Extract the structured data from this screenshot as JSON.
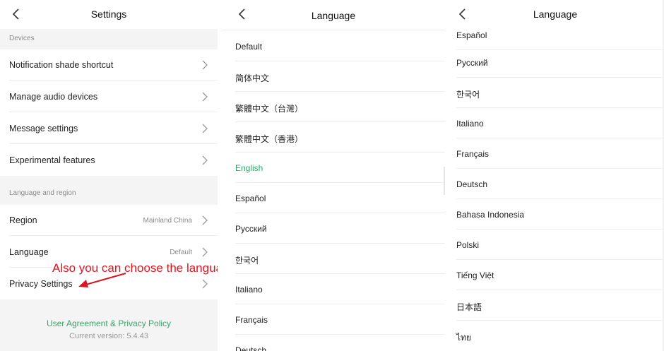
{
  "settings": {
    "title": "Settings",
    "section_devices": "Devices",
    "devices_items": [
      {
        "label": "Notification shade shortcut"
      },
      {
        "label": "Manage audio devices"
      },
      {
        "label": "Message settings"
      },
      {
        "label": "Experimental features"
      }
    ],
    "section_language_region": "Language and region",
    "region": {
      "label": "Region",
      "value": "Mainland China"
    },
    "language": {
      "label": "Language",
      "value": "Default"
    },
    "privacy": {
      "label": "Privacy Settings"
    },
    "footer_link": "User Agreement & Privacy Policy",
    "version": "Current version: 5.4.43"
  },
  "annotation": {
    "text": "Also you can choose the language",
    "color": "#e0141e"
  },
  "language_list_1": {
    "title": "Language",
    "items": [
      "Default",
      "简体中文",
      "繁體中文（台灣）",
      "繁體中文（香港）",
      "English",
      "Español",
      "Русский",
      "한국어",
      "Italiano",
      "Français",
      "Deutsch"
    ],
    "selected": "English",
    "selected_color": "#2ea96a"
  },
  "language_list_2": {
    "title": "Language",
    "items": [
      "Español",
      "Русский",
      "한국어",
      "Italiano",
      "Français",
      "Deutsch",
      "Bahasa Indonesia",
      "Polski",
      "Tiếng Việt",
      "日本語",
      "ไทย"
    ]
  }
}
